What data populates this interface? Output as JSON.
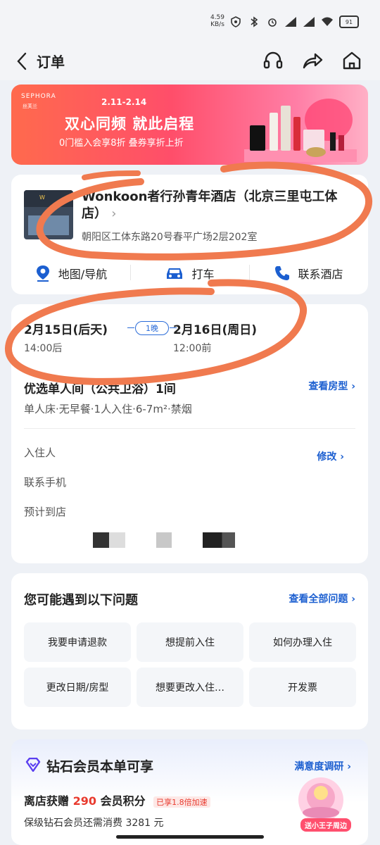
{
  "status_bar": {
    "net_speed_value": "4.59",
    "net_speed_unit": "KB/s",
    "battery": "91"
  },
  "header": {
    "title": "订单"
  },
  "banner": {
    "brand": "SEPHORA",
    "brand_cn": "丝芙兰",
    "dates": "2.11-2.14",
    "headline": "双心同频 就此启程",
    "subline": "0门槛入会享8折 叠券享折上折"
  },
  "hotel": {
    "name": "Wonkoon者行孙青年酒店（北京三里屯工体店）",
    "chevron": "›",
    "address": "朝阳区工体东路20号春平广场2层202室",
    "actions": [
      {
        "label": "地图/导航",
        "icon": "map-pin-icon"
      },
      {
        "label": "打车",
        "icon": "car-icon"
      },
      {
        "label": "联系酒店",
        "icon": "phone-icon"
      }
    ]
  },
  "booking": {
    "checkin_date": "2月15日(后天)",
    "checkin_time": "14:00后",
    "nights": "1晚",
    "checkout_date": "2月16日(周日)",
    "checkout_time": "12:00前",
    "room_title": "优选单人间（公共卫浴）1间",
    "room_info": "单人床·无早餐·1人入住·6-7m²·禁烟",
    "view_room": "查看房型 ›",
    "guest_label": "入住人",
    "phone_label": "联系手机",
    "arrival_label": "预计到店",
    "modify": "修改 ›"
  },
  "faq": {
    "title": "您可能遇到以下问题",
    "view_all": "查看全部问题 ›",
    "items": [
      "我要申请退款",
      "想提前入住",
      "如何办理入住",
      "更改日期/房型",
      "想要更改入住…",
      "开发票"
    ]
  },
  "member": {
    "title": "钻石会员本单可享",
    "survey": "满意度调研 ›",
    "points_prefix": "离店获赠",
    "points_value": "290",
    "points_suffix": "会员积分",
    "boost": "已享1.8倍加速",
    "keep_text": "保级钻石会员还需消费 3281 元",
    "promo_label": "送小王子周边"
  },
  "colors": {
    "accent": "#1c5fd0",
    "highlight": "#e83a2e",
    "annotation": "#f07a4f"
  }
}
